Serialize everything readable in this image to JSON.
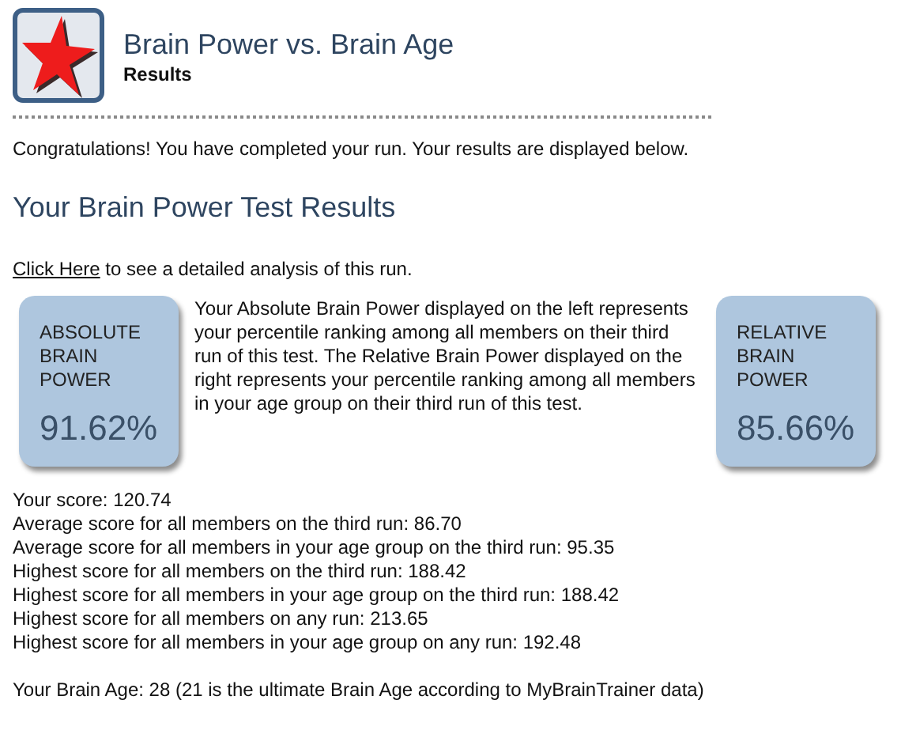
{
  "header": {
    "title": "Brain Power vs. Brain Age",
    "subtitle": "Results"
  },
  "intro": "Congratulations! You have completed your run. Your results are displayed below.",
  "heading": "Your Brain Power Test Results",
  "analysis": {
    "link": "Click Here",
    "text": " to see a detailed analysis of this run."
  },
  "boxes": [
    {
      "label": "ABSOLUTE BRAIN POWER",
      "value": "91.62%"
    },
    {
      "label": "RELATIVE BRAIN POWER",
      "value": "85.66%"
    }
  ],
  "explanation": "Your Absolute Brain Power displayed on the left represents your percentile ranking among all members on their third run of this test. The Relative Brain Power displayed on the right represents your percentile ranking among all members in your age group on their third run of this test.",
  "scores": [
    "Your score: 120.74",
    "Average score for all members on the third run: 86.70",
    "Average score for all members in your age group on the third run: 95.35",
    "Highest score for all members on the third run: 188.42",
    "Highest score for all members in your age group on the third run: 188.42",
    "Highest score for all members on any run: 213.65",
    "Highest score for all members in your age group on any run: 192.48"
  ],
  "brain_age": "Your Brain Age: 28 (21 is the ultimate Brain Age according to MyBrainTrainer data)"
}
